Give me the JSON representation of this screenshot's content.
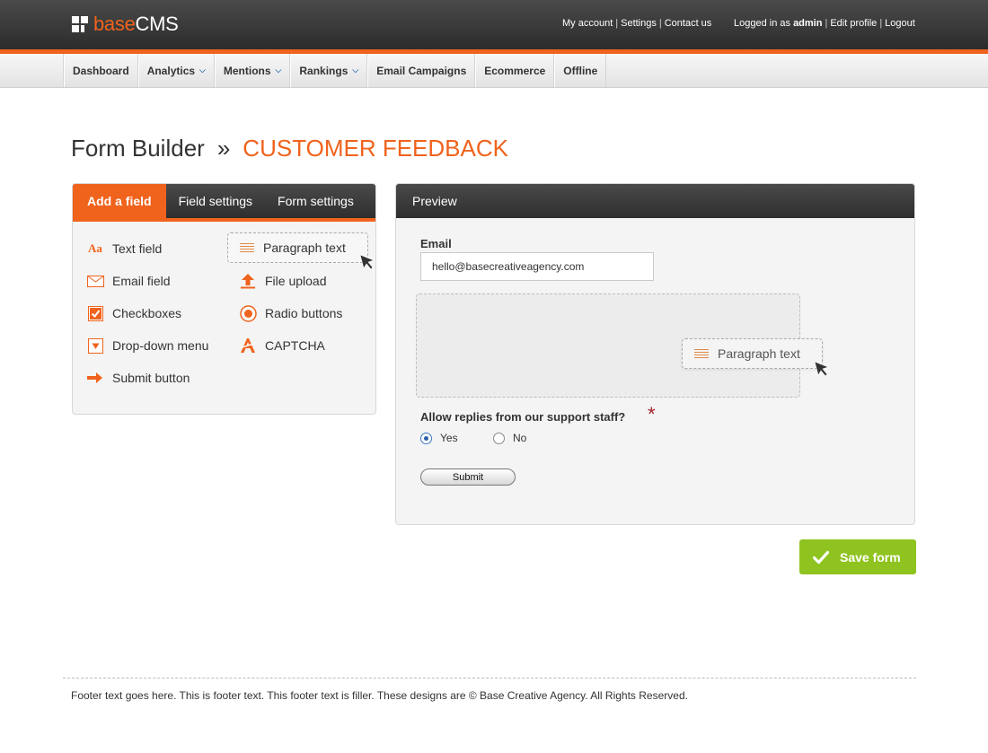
{
  "header": {
    "logo": {
      "part1": "base",
      "part2": "CMS"
    },
    "links_left": [
      "My account",
      "Settings",
      "Contact us"
    ],
    "logged_in_prefix": "Logged in as",
    "username": "admin",
    "links_right": [
      "Edit profile",
      "Logout"
    ]
  },
  "nav": {
    "items": [
      {
        "label": "Dashboard",
        "dropdown": false
      },
      {
        "label": "Analytics",
        "dropdown": true
      },
      {
        "label": "Mentions",
        "dropdown": true
      },
      {
        "label": "Rankings",
        "dropdown": true
      },
      {
        "label": "Email Campaigns",
        "dropdown": false
      },
      {
        "label": "Ecommerce",
        "dropdown": false
      },
      {
        "label": "Offline",
        "dropdown": false
      }
    ]
  },
  "page": {
    "title": "Form Builder",
    "separator": "»",
    "form_name": "CUSTOMER FEEDBACK"
  },
  "left_panel": {
    "tabs": [
      "Add a field",
      "Field settings",
      "Form settings"
    ],
    "fields": [
      {
        "label": "Text field",
        "icon": "text-field-icon"
      },
      {
        "label": "Paragraph text",
        "icon": "paragraph-icon"
      },
      {
        "label": "Email field",
        "icon": "envelope-icon"
      },
      {
        "label": "File upload",
        "icon": "upload-icon"
      },
      {
        "label": "Checkboxes",
        "icon": "checkbox-icon"
      },
      {
        "label": "Radio buttons",
        "icon": "radio-icon"
      },
      {
        "label": "Drop-down menu",
        "icon": "dropdown-icon"
      },
      {
        "label": "CAPTCHA",
        "icon": "captcha-icon"
      },
      {
        "label": "Submit button",
        "icon": "arrow-right-icon"
      }
    ]
  },
  "preview": {
    "heading": "Preview",
    "email_label": "Email",
    "email_value": "hello@basecreativeagency.com",
    "dragging_label": "Paragraph text",
    "question": "Allow replies from our support staff?",
    "required_mark": "*",
    "options": [
      "Yes",
      "No"
    ],
    "selected_option": "Yes",
    "submit_label": "Submit"
  },
  "save_button": "Save form",
  "footer": "Footer text goes here. This is footer text. This footer text is filler. These designs are © Base Creative Agency. All Rights Reserved.",
  "colors": {
    "accent": "#f0631d",
    "save": "#8fc31f",
    "dark_bar": "#2c2c2c"
  }
}
